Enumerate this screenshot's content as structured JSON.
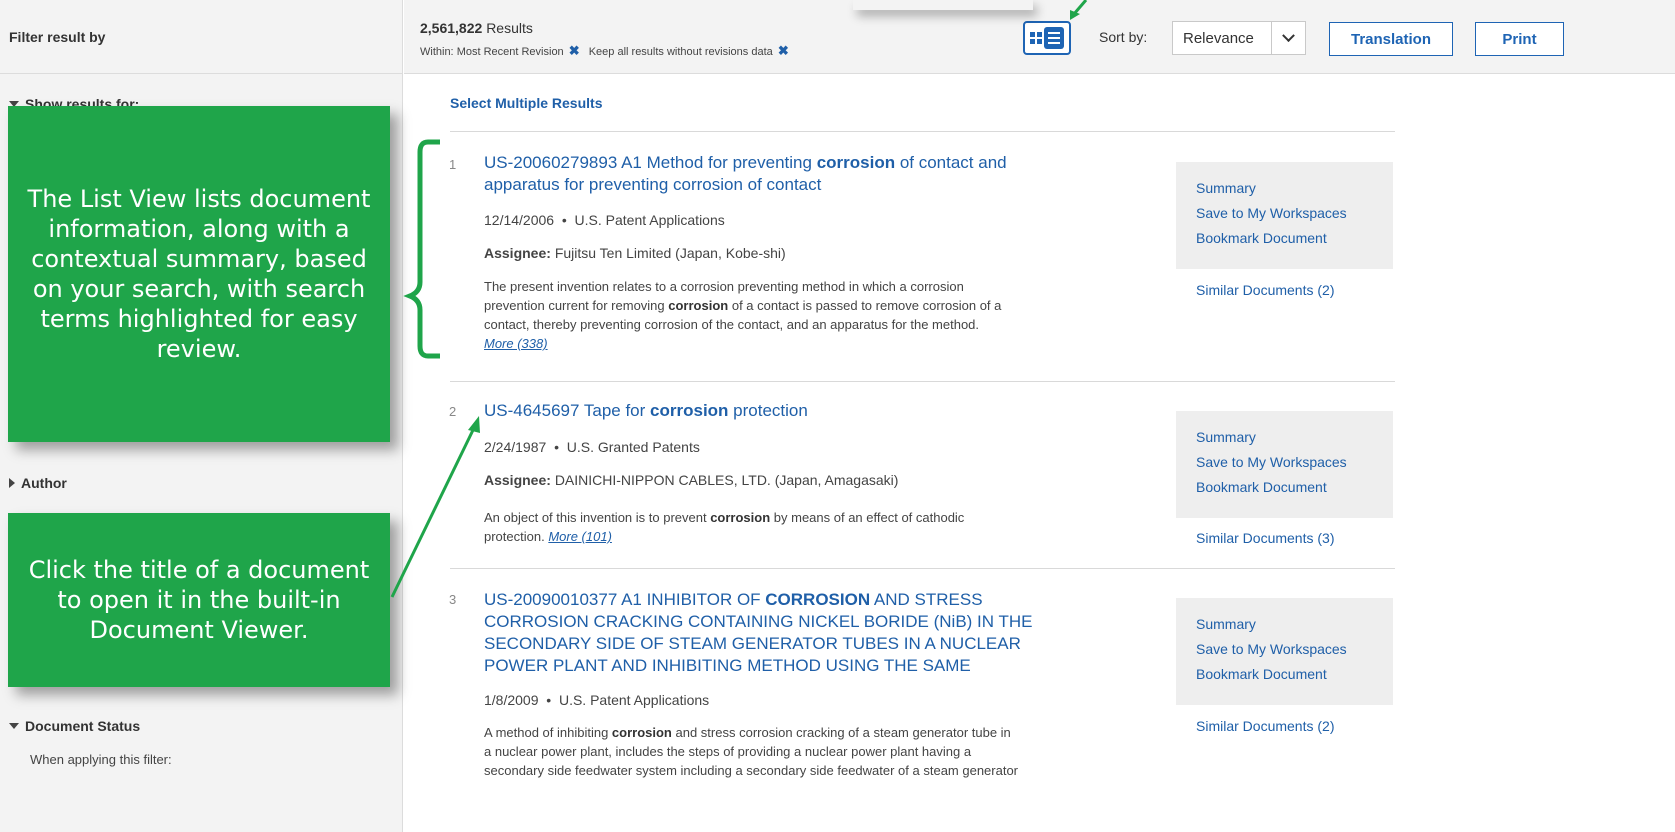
{
  "sidebar": {
    "header": "Filter result by",
    "section_show_results": "Show results for:",
    "section_author": "Author",
    "section_document_status": "Document Status",
    "document_status_note": "When applying this filter:"
  },
  "topbar": {
    "count_number": "2,561,822",
    "count_label": "Results",
    "within_label": "Within:",
    "within_filter_1": "Most Recent Revision",
    "within_filter_2": "Keep all results without revisions data",
    "remove_icon_glyph": "✖",
    "sort_label": "Sort by:",
    "sort_value": "Relevance",
    "translation_label": "Translation",
    "print_label": "Print"
  },
  "results_header": {
    "select_multiple": "Select Multiple Results"
  },
  "actions_labels": {
    "summary": "Summary",
    "save": "Save to My Workspaces",
    "bookmark": "Bookmark Document"
  },
  "results": [
    {
      "num": "1",
      "title_pre": "US-20060279893 A1 Method for preventing ",
      "title_hl": "corrosion",
      "title_post": " of contact and",
      "title_line2": "apparatus for preventing corrosion of contact",
      "date": "12/14/2006",
      "source": "U.S. Patent Applications",
      "assignee_label": "Assignee:",
      "assignee": "Fujitsu Ten Limited (Japan, Kobe-shi)",
      "abs_line1": "The present invention relates to a corrosion preventing method in which a corrosion",
      "abs_line2_pre": "prevention current for removing ",
      "abs_line2_hl": "corrosion",
      "abs_line2_post": " of a contact is passed to remove corrosion of a",
      "abs_line3": "contact, thereby preventing corrosion of the contact, and an apparatus for the method.",
      "more": "More (338)",
      "similar": "Similar Documents (2)"
    },
    {
      "num": "2",
      "title_pre": "US-4645697 Tape for ",
      "title_hl": "corrosion",
      "title_post": " protection",
      "date": "2/24/1987",
      "source": "U.S. Granted Patents",
      "assignee_label": "Assignee:",
      "assignee": "DAINICHI-NIPPON CABLES, LTD. (Japan, Amagasaki)",
      "abs_line1_pre": "An object of this invention is to prevent ",
      "abs_line1_hl": "corrosion",
      "abs_line1_post": " by means of an effect of cathodic",
      "abs_line2": "protection.",
      "more": "More (101)",
      "similar": "Similar Documents (3)"
    },
    {
      "num": "3",
      "title_pre": "US-20090010377 A1 INHIBITOR OF ",
      "title_hl": "CORROSION",
      "title_post": " AND STRESS",
      "title_line2": "CORROSION CRACKING CONTAINING NICKEL BORIDE (NiB) IN THE",
      "title_line3": "SECONDARY SIDE OF STEAM GENERATOR TUBES IN A NUCLEAR",
      "title_line4": "POWER PLANT AND INHIBITING METHOD USING THE SAME",
      "date": "1/8/2009",
      "source": "U.S. Patent Applications",
      "abs_line1_pre": "A method of inhibiting ",
      "abs_line1_hl": "corrosion",
      "abs_line1_post": " and stress corrosion cracking of a steam generator tube in",
      "abs_line2": "a nuclear power plant, includes the steps of providing a nuclear power plant having a",
      "abs_line3": "secondary side feedwater system including a secondary side feedwater of a steam generator",
      "similar": "Similar Documents (2)"
    }
  ],
  "callouts": {
    "list_view": "The List View lists document information, along with a contextual summary, based on your search, with search terms highlighted for easy review.",
    "click_title": "Click the title of a document to open it in the built-in Document Viewer."
  },
  "colors": {
    "callout_green": "#1fa54a",
    "link_blue": "#1f5fa8",
    "accent_blue": "#1e64b4"
  }
}
